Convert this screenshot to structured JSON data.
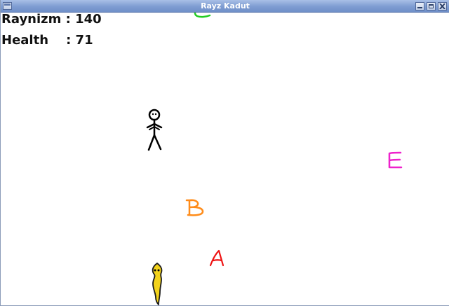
{
  "window": {
    "title": "Rayz Kadut"
  },
  "hud": {
    "score_label": "Raynizm : 140",
    "health_label": "Health    : 71",
    "score": 140,
    "health": 71
  },
  "letters": [
    {
      "char": "C",
      "color": "#22cc22"
    },
    {
      "char": "E",
      "color": "#ee22cc"
    },
    {
      "char": "B",
      "color": "#ff8c1a"
    },
    {
      "char": "A",
      "color": "#ee1111"
    }
  ],
  "sprites": {
    "player_icon": "stick-figure-icon",
    "enemy_icon": "yellow-worm-icon"
  }
}
